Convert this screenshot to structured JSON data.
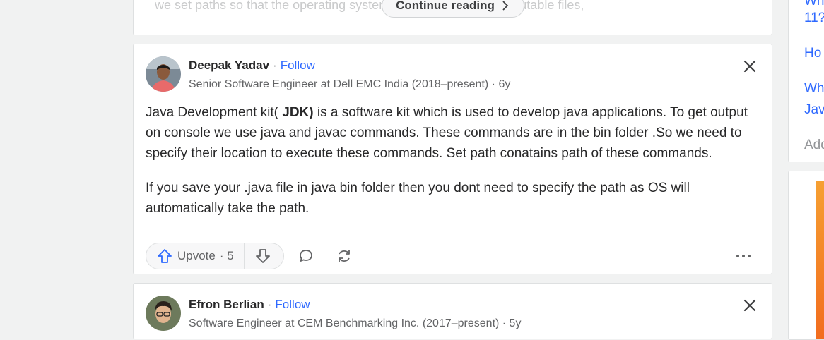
{
  "prev_card": {
    "faded_text": "we set paths so that the operating system can find the Java executable files,",
    "continue_label": "Continue reading"
  },
  "answer": {
    "author_name": "Deepak Yadav",
    "separator": "·",
    "follow_label": "Follow",
    "credential": "Senior Software Engineer at Dell EMC India (2018–present) · 6y",
    "paragraph1_a": "Java Development kit( ",
    "paragraph1_bold": "JDK)",
    "paragraph1_b": " is a software kit which is used to develop java applications. To get output on console we use java and javac commands. These commands are in the bin folder .So we need to specify their location to execute these commands. Set path conatains path of these commands.",
    "paragraph2": "If you save your .java file in java bin folder then you dont need to specify the path as OS will automatically take the path.",
    "upvote_label": "Upvote",
    "upvote_count": "· 5"
  },
  "next_card": {
    "author_name": "Efron Berlian",
    "separator": "·",
    "follow_label": "Follow",
    "credential": "Software Engineer at CEM Benchmarking Inc. (2017–present) · 5y"
  },
  "sidebar": {
    "link1_line1": "Wh",
    "link1_line2": "11?",
    "link2": "Ho",
    "link3_line1": "Wh",
    "link3_line2": "Jav",
    "add_label": "Add"
  },
  "colors": {
    "accent": "#2e69ff",
    "text": "#282829",
    "muted": "#636466",
    "background": "#f1f2f2"
  }
}
